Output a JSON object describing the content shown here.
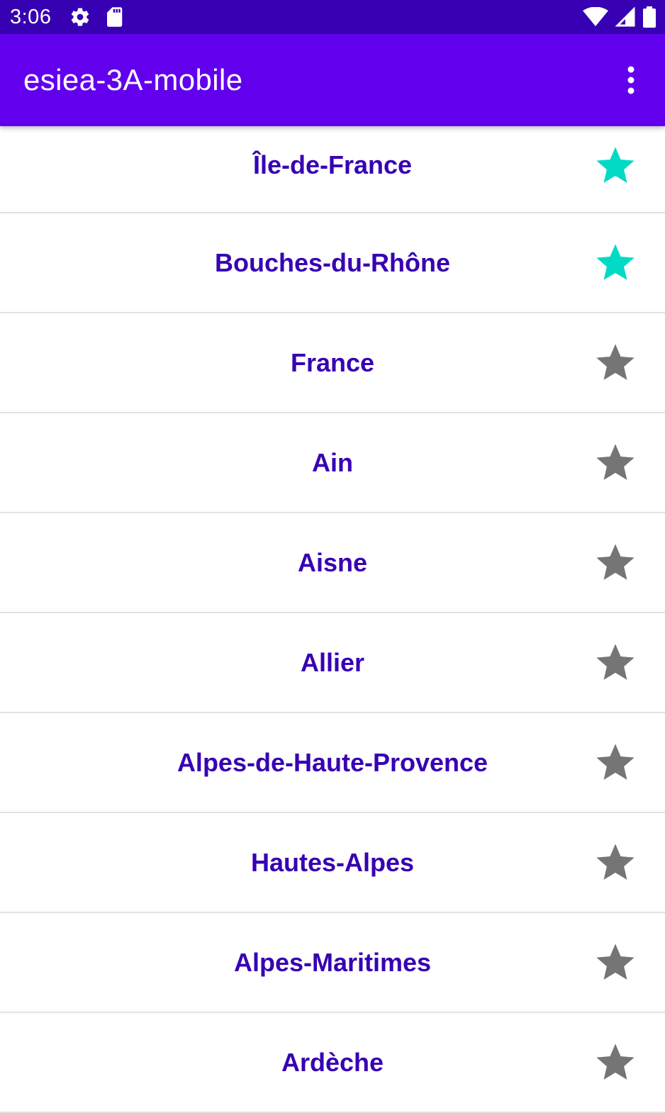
{
  "status_bar": {
    "time": "3:06",
    "icons_left": [
      "gear-icon",
      "sd-card-icon"
    ],
    "icons_right": [
      "wifi-icon",
      "signal-icon",
      "battery-icon"
    ]
  },
  "app_bar": {
    "title": "esiea-3A-mobile",
    "menu_icon": "more-vert-icon"
  },
  "colors": {
    "status_bar": "#3700b3",
    "app_bar": "#6200ee",
    "item_text": "#3700b3",
    "star_favorite": "#03dac5",
    "star_default": "#757575",
    "divider": "#e2e2e2"
  },
  "list": {
    "items": [
      {
        "label": "Île-de-France",
        "favorite": true
      },
      {
        "label": "Bouches-du-Rhône",
        "favorite": true
      },
      {
        "label": "France",
        "favorite": false
      },
      {
        "label": "Ain",
        "favorite": false
      },
      {
        "label": "Aisne",
        "favorite": false
      },
      {
        "label": "Allier",
        "favorite": false
      },
      {
        "label": "Alpes-de-Haute-Provence",
        "favorite": false
      },
      {
        "label": "Hautes-Alpes",
        "favorite": false
      },
      {
        "label": "Alpes-Maritimes",
        "favorite": false
      },
      {
        "label": "Ardèche",
        "favorite": false
      }
    ]
  }
}
